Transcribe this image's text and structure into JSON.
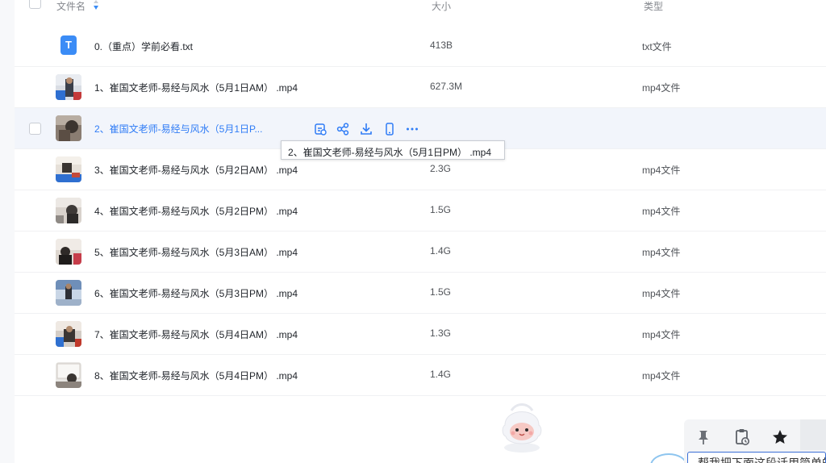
{
  "header": {
    "col_name": "文件名",
    "col_size": "大小",
    "col_type": "类型"
  },
  "files": [
    {
      "name": "0.（重点）学前必看.txt",
      "size": "413B",
      "type": "txt文件",
      "icon": "txt-file-icon",
      "icon_letter": "T"
    },
    {
      "name": "1、崔国文老师-易经与风水（5月1日AM） .mp4",
      "size": "627.3M",
      "type": "mp4文件",
      "icon": "video-thumbnail"
    },
    {
      "name": "2、崔国文老师-易经与风水（5月1日P...",
      "size": "",
      "type": "",
      "icon": "video-thumbnail",
      "hovered": true
    },
    {
      "name": "3、崔国文老师-易经与风水（5月2日AM） .mp4",
      "size": "2.3G",
      "type": "mp4文件",
      "icon": "video-thumbnail"
    },
    {
      "name": "4、崔国文老师-易经与风水（5月2日PM） .mp4",
      "size": "1.5G",
      "type": "mp4文件",
      "icon": "video-thumbnail"
    },
    {
      "name": "5、崔国文老师-易经与风水（5月3日AM） .mp4",
      "size": "1.4G",
      "type": "mp4文件",
      "icon": "video-thumbnail"
    },
    {
      "name": "6、崔国文老师-易经与风水（5月3日PM） .mp4",
      "size": "1.5G",
      "type": "mp4文件",
      "icon": "video-thumbnail"
    },
    {
      "name": "7、崔国文老师-易经与风水（5月4日AM） .mp4",
      "size": "1.3G",
      "type": "mp4文件",
      "icon": "video-thumbnail"
    },
    {
      "name": "8、崔国文老师-易经与风水（5月4日PM） .mp4",
      "size": "1.4G",
      "type": "mp4文件",
      "icon": "video-thumbnail"
    }
  ],
  "row_actions": [
    "cloud-save-icon",
    "share-icon",
    "download-icon",
    "phone-icon",
    "more-icon"
  ],
  "tooltip": {
    "text": "2、崔国文老师-易经与风水（5月1日PM） .mp4"
  },
  "assistant_panel": {
    "tools": [
      "pin-icon",
      "clipboard-history-icon",
      "star-icon"
    ],
    "input_text": "帮我把下面这段话用简单的"
  },
  "colors": {
    "accent": "#2f7cf6",
    "hover_row": "#f2f5fb",
    "txt_icon": "#3b8cf6"
  }
}
